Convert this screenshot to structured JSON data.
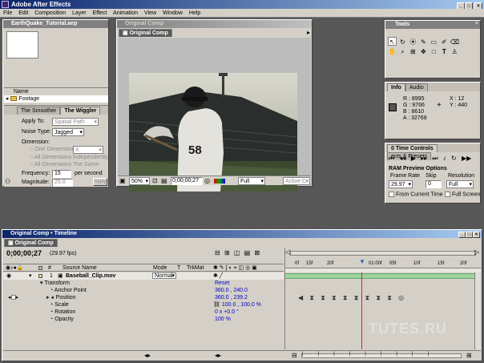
{
  "app": {
    "title": "Adobe After Effects",
    "menu": [
      "File",
      "Edit",
      "Composition",
      "Layer",
      "Effect",
      "Animation",
      "View",
      "Window",
      "Help"
    ]
  },
  "project": {
    "title": "EarthQuake_Tutorial.aep",
    "column_name": "Name",
    "folder": "Footage"
  },
  "wiggler": {
    "tabs": [
      "The Smoother",
      "The Wiggler"
    ],
    "apply_to_label": "Apply To:",
    "apply_to_value": "Spatial Path",
    "noise_type_label": "Noise Type:",
    "noise_type_value": "Jagged",
    "dimension_label": "Dimension:",
    "one_dimension": "One Dimension",
    "one_dimension_axis": "X",
    "all_independently": "All Dimensions Independently",
    "all_same": "All Dimensions The Same",
    "frequency_label": "Frequency:",
    "frequency_value": "15",
    "frequency_unit": "per second",
    "magnitude_label": "Magnitude:",
    "magnitude_value": "25.0",
    "apply_button": "Apply"
  },
  "comp_window": {
    "title": "Original Comp",
    "tab": "Original Comp",
    "zoom": "50%",
    "timecode": "0;00;00;27",
    "resolution": "Full",
    "camera": "Active C",
    "jersey_number": "58"
  },
  "tools": {
    "title": "Tools",
    "icons": [
      "arrow-icon",
      "rotate-icon",
      "orbit-icon",
      "pen-icon",
      "rect-mask-icon",
      "eraser-icon",
      "hand-icon",
      "zoom-icon",
      "pan-behind-icon",
      "track-icon",
      "camera-icon",
      "text-icon",
      "brush-icon",
      "clone-icon"
    ]
  },
  "info": {
    "tabs": [
      "Info",
      "Audio"
    ],
    "r": "R : 8995",
    "g": "G : 9766",
    "b": "B : 8610",
    "a": "A : 32768",
    "x": "X : 12",
    "y": "Y : 440",
    "swatch_color": "#555555"
  },
  "time_controls": {
    "tabs": [
      "0 Time Controls",
      "ects & Presets"
    ],
    "ram_preview_title": "RAM Preview Options",
    "frame_rate_label": "Frame Rate",
    "frame_rate_value": "29.97",
    "skip_label": "Skip",
    "skip_value": "0",
    "resolution_label": "Resolution",
    "resolution_value": "Full",
    "from_current_time": "From Current Time",
    "full_screen": "Full Screen"
  },
  "timeline": {
    "title": "Original Comp • Timeline",
    "tab": "Original Comp",
    "timecode": "0;00;00;27",
    "fps": "(29.97 fps)",
    "headers": {
      "num": "#",
      "source_name": "Source Name",
      "mode": "Mode",
      "t": "T",
      "trkmat": "TrkMat"
    },
    "ruler_ticks": [
      "0f",
      "15f",
      "20f",
      "01:00f",
      "05f",
      "10f",
      "15f",
      "20f"
    ],
    "layer": {
      "index": "1",
      "name": "Baseball_Clip.mov",
      "mode": "Normal"
    },
    "properties": [
      {
        "name": "Transform",
        "value": "Reset"
      },
      {
        "name": "Anchor Point",
        "value": "360.0 , 240.0"
      },
      {
        "name": "Position",
        "value": "360.0 , 239.2"
      },
      {
        "name": "Scale",
        "value": "100.0 , 100.0 %"
      },
      {
        "name": "Rotation",
        "value": "0 x +0.0 °"
      },
      {
        "name": "Opacity",
        "value": "100 %"
      }
    ]
  },
  "watermark": "TUTES.RU"
}
